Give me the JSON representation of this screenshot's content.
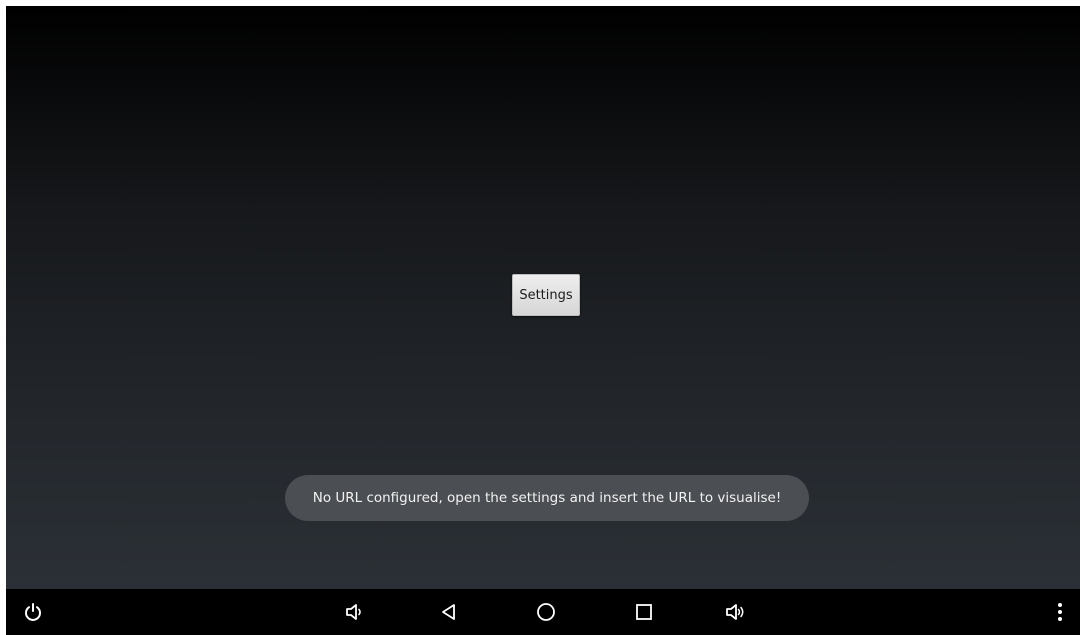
{
  "main": {
    "settings_button_label": "Settings"
  },
  "toast": {
    "message": "No URL configured, open the settings and insert the URL to visualise!"
  },
  "navbar": {
    "icons": [
      "power-icon",
      "volume-down-icon",
      "back-icon",
      "home-icon",
      "recents-icon",
      "volume-up-icon",
      "overflow-menu-icon"
    ]
  },
  "colors": {
    "screen_top": "#000000",
    "screen_bottom": "#2b3036",
    "toast_background": "#4b4e52",
    "navbar_background": "#000000",
    "icon_color": "#ffffff"
  }
}
